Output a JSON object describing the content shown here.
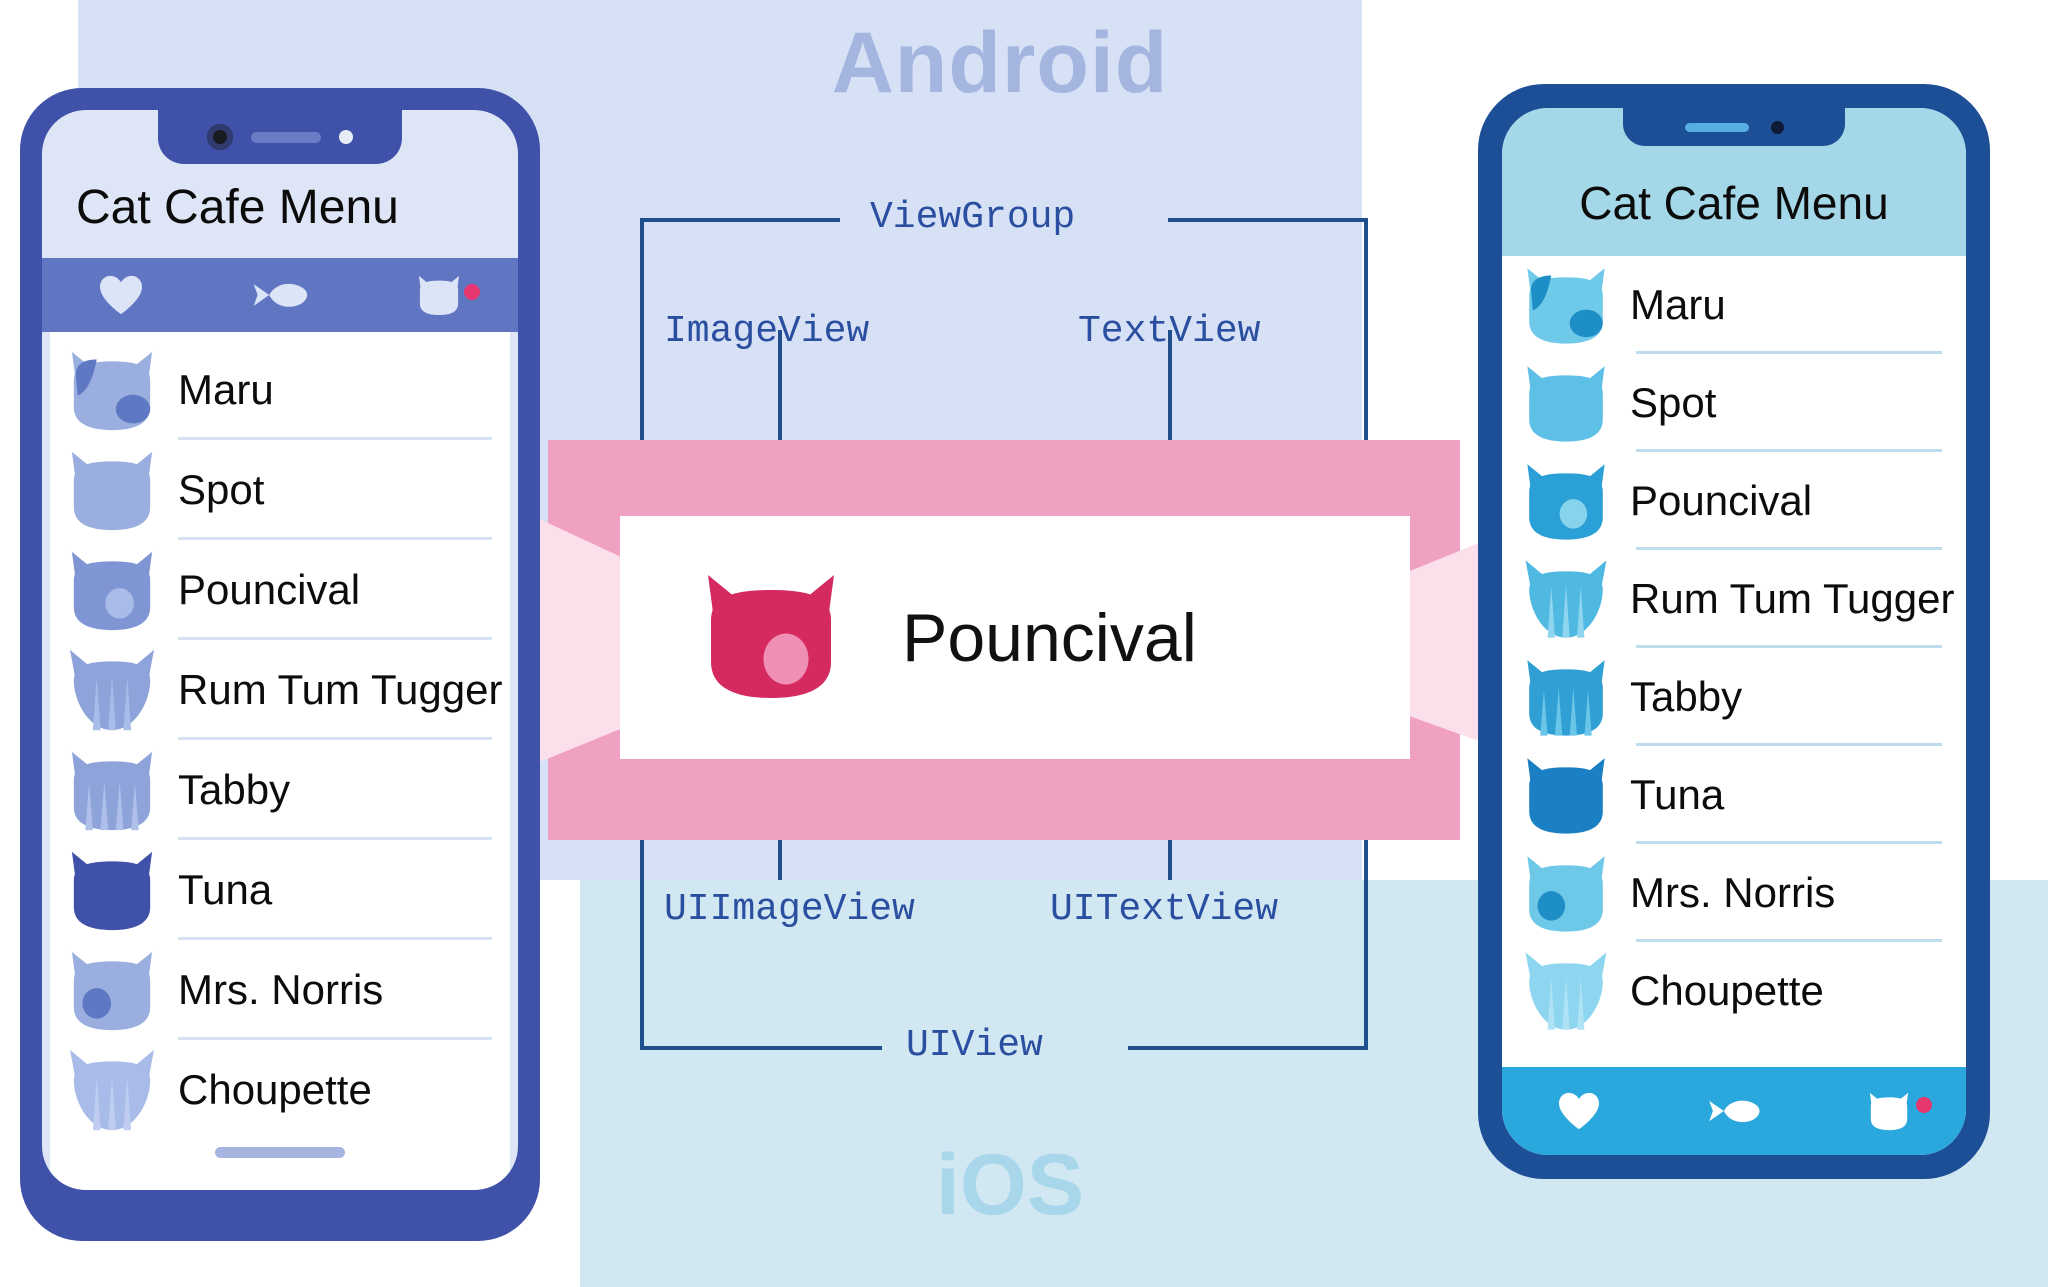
{
  "platforms": {
    "android_label": "Android",
    "ios_label": "iOS"
  },
  "diagram": {
    "top_group": "ViewGroup",
    "top_left": "ImageView",
    "top_right": "TextView",
    "bottom_left": "UIImageView",
    "bottom_right": "UITextView",
    "bottom_group": "UIView"
  },
  "callout": {
    "image_name": "cat-avatar-pink",
    "label": "Pouncival"
  },
  "android_phone": {
    "title": "Cat Cafe Menu",
    "tabs": [
      {
        "name": "heart-icon",
        "label": "Favorites"
      },
      {
        "name": "fish-icon",
        "label": "Food"
      },
      {
        "name": "cat-icon",
        "label": "Cats",
        "badge": true
      }
    ],
    "items": [
      {
        "name": "Maru"
      },
      {
        "name": "Spot"
      },
      {
        "name": "Pouncival"
      },
      {
        "name": "Rum Tum Tugger"
      },
      {
        "name": "Tabby"
      },
      {
        "name": "Tuna"
      },
      {
        "name": "Mrs. Norris"
      },
      {
        "name": "Choupette"
      }
    ]
  },
  "ios_phone": {
    "title": "Cat Cafe Menu",
    "tabs": [
      {
        "name": "heart-icon",
        "label": "Favorites"
      },
      {
        "name": "fish-icon",
        "label": "Food"
      },
      {
        "name": "cat-icon",
        "label": "Cats",
        "badge": true
      }
    ],
    "items": [
      {
        "name": "Maru"
      },
      {
        "name": "Spot"
      },
      {
        "name": "Pouncival"
      },
      {
        "name": "Rum Tum Tugger"
      },
      {
        "name": "Tabby"
      },
      {
        "name": "Tuna"
      },
      {
        "name": "Mrs. Norris"
      },
      {
        "name": "Choupette"
      }
    ]
  },
  "colors": {
    "android_band": "#d7e1f5",
    "ios_band": "#d1e7f2",
    "android_word": "#a4b5e0",
    "ios_word": "#a8d6ea",
    "pink_band": "#f0a0c0",
    "funnel": "#fbdfeb",
    "diagram_line": "#1f4e8c",
    "diagram_label": "#2b4fa0",
    "android_frame": "#3f51a8",
    "android_screen": "#dde5f6",
    "android_tabbar": "#6176c2",
    "ios_frame": "#1c4f96",
    "ios_header": "#a4d7e8",
    "ios_tabbar": "#2aa8dd",
    "callout_cat": "#d42a60",
    "badge": "#e8366f"
  }
}
